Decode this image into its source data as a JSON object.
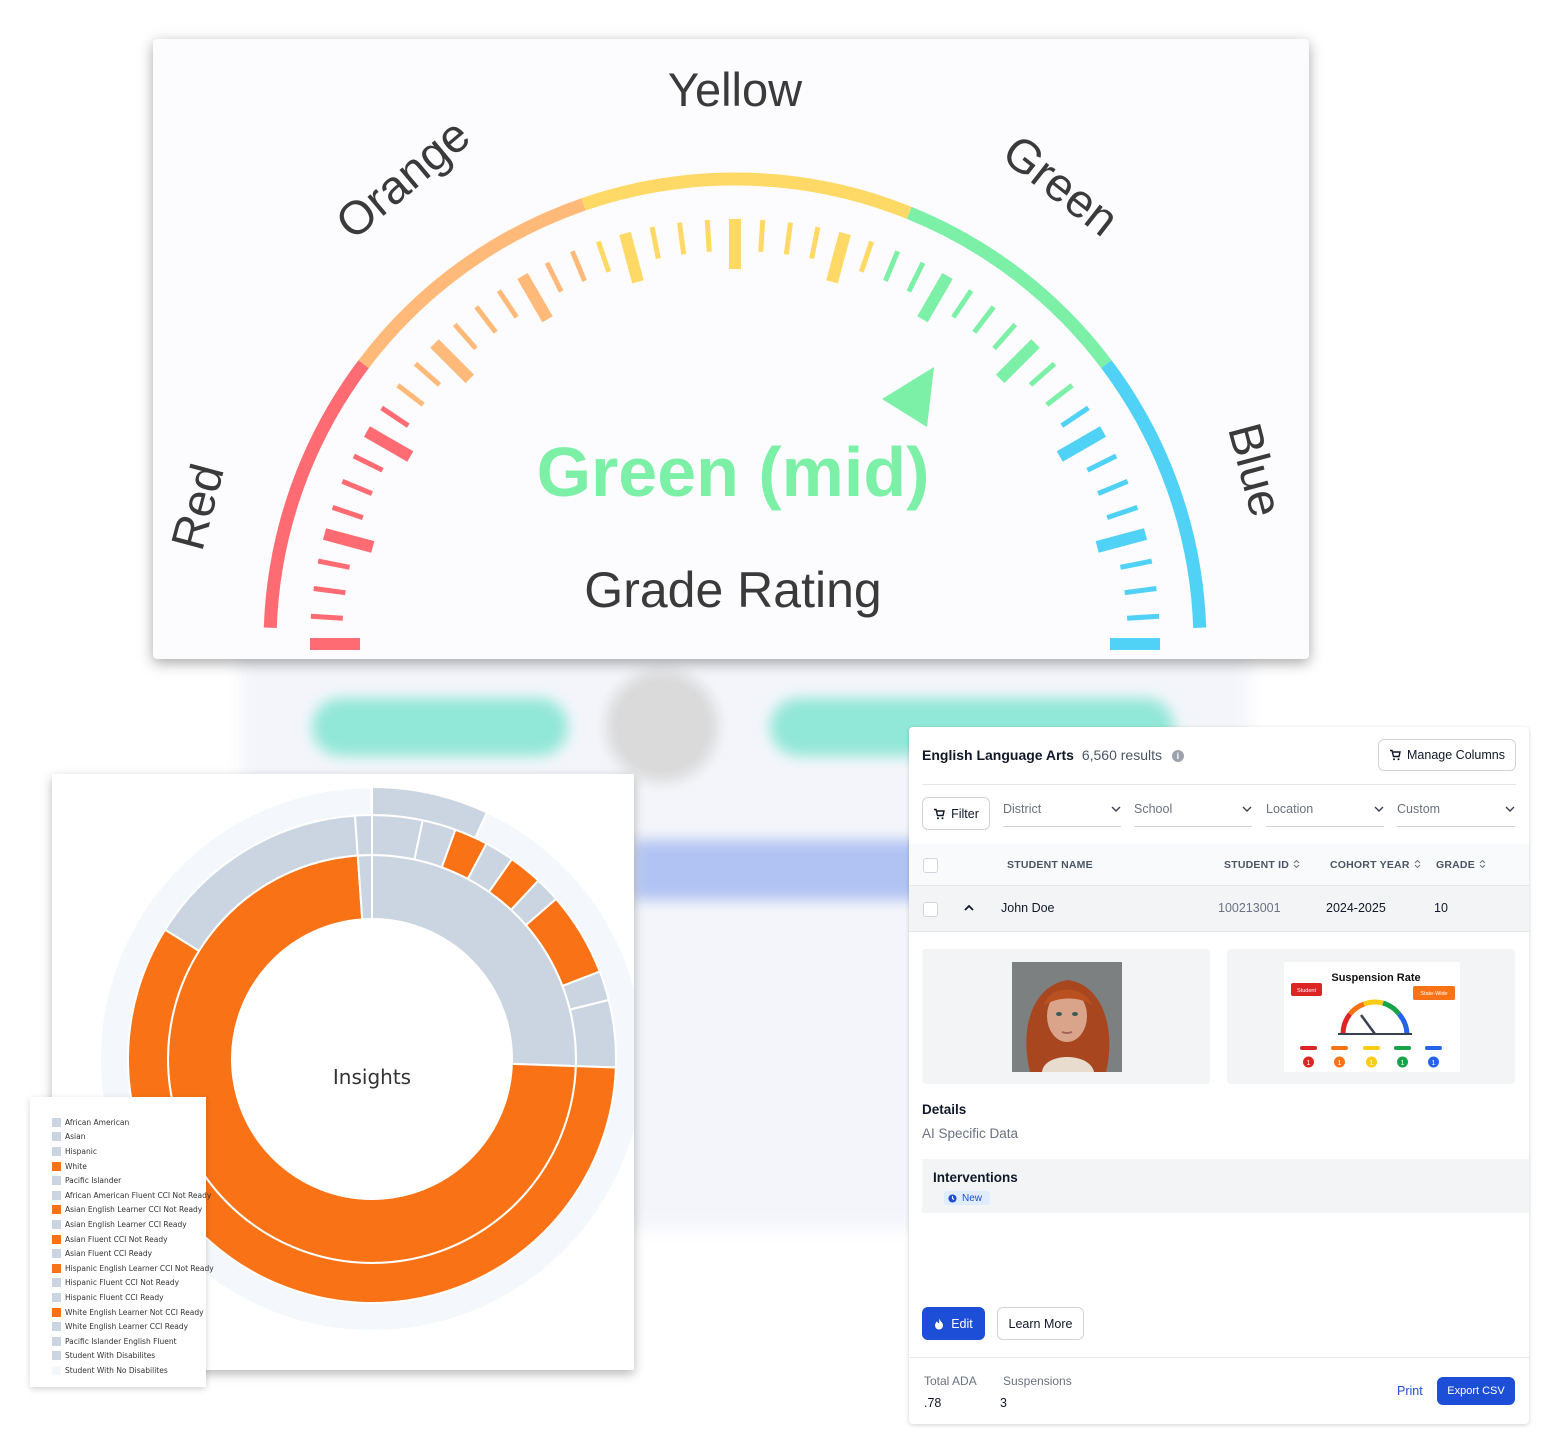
{
  "gauge": {
    "labels": {
      "red": "Red",
      "orange": "Orange",
      "yellow": "Yellow",
      "green": "Green",
      "blue": "Blue"
    },
    "value_text": "Green (mid)",
    "caption": "Grade Rating",
    "colors": {
      "red": "#ff6b72",
      "orange": "#ffba7a",
      "yellow": "#ffd966",
      "green": "#7bf0a6",
      "blue": "#4fd2f5",
      "value": "#7bf0a6"
    }
  },
  "sunburst": {
    "center_label": "Insights",
    "colors": {
      "orange": "#f97316",
      "grey": "#cbd5e1",
      "track": "#f4f7fb"
    },
    "legend": [
      {
        "label": "African American",
        "color": "grey"
      },
      {
        "label": "Asian",
        "color": "grey"
      },
      {
        "label": "Hispanic",
        "color": "grey"
      },
      {
        "label": "White",
        "color": "orange"
      },
      {
        "label": "Pacific Islander",
        "color": "grey"
      },
      {
        "label": "African American Fluent CCI Not Ready",
        "color": "grey"
      },
      {
        "label": "Asian English Learner CCI Not Ready",
        "color": "orange"
      },
      {
        "label": "Asian English Learner CCI Ready",
        "color": "grey"
      },
      {
        "label": "Asian Fluent CCI Not Ready",
        "color": "orange"
      },
      {
        "label": "Asian Fluent CCI Ready",
        "color": "grey"
      },
      {
        "label": "Hispanic English Learner CCI Not Ready",
        "color": "orange"
      },
      {
        "label": "Hispanic Fluent CCI Not Ready",
        "color": "grey"
      },
      {
        "label": "Hispanic Fluent CCI Ready",
        "color": "grey"
      },
      {
        "label": "White English Learner Not CCI Ready",
        "color": "orange"
      },
      {
        "label": "White English Learner CCI Ready",
        "color": "grey"
      },
      {
        "label": "Pacific Islander English Fluent",
        "color": "grey"
      },
      {
        "label": "Student With Disabilites",
        "color": "grey"
      },
      {
        "label": "Student With No Disabilites",
        "color": "track"
      }
    ]
  },
  "table": {
    "title": "English Language Arts",
    "count": "6,560 results",
    "manage_columns": "Manage Columns",
    "filter": "Filter",
    "filters": [
      "District",
      "School",
      "Location",
      "Custom"
    ],
    "columns": [
      "STUDENT NAME",
      "STUDENT ID",
      "COHORT YEAR",
      "GRADE"
    ],
    "row": {
      "name": "John Doe",
      "id": "100213001",
      "cohort": "2024-2025",
      "grade": "10"
    },
    "suspension_title": "Suspension Rate",
    "suspension_student_tag": "Student",
    "suspension_state_tag": "State-Wide",
    "suspension_counts": [
      "1",
      "1",
      "1",
      "1",
      "1"
    ],
    "details_label": "Details",
    "details_value": "AI Specific Data",
    "interventions_label": "Interventions",
    "interventions_badge": "New",
    "edit_label": "Edit",
    "learn_more_label": "Learn More",
    "footer": {
      "total_ada_label": "Total ADA",
      "total_ada_value": ".78",
      "suspensions_label": "Suspensions",
      "suspensions_value": "3",
      "print_label": "Print",
      "export_label": "Export CSV"
    }
  }
}
